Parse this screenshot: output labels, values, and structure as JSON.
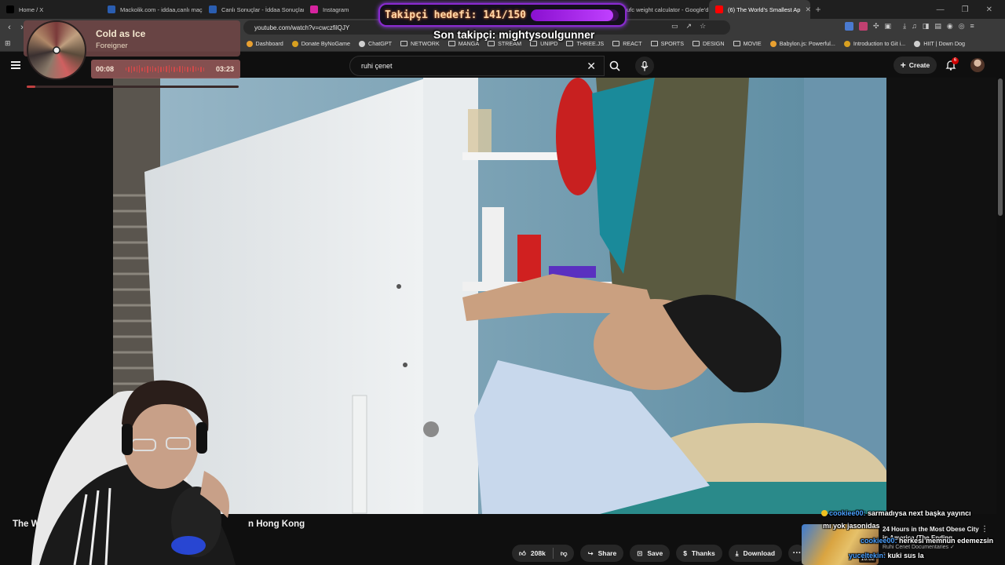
{
  "browser": {
    "tabs": [
      {
        "label": "Home / X",
        "icon": "x-icon",
        "color": "#000000"
      },
      {
        "label": "Mackolik.com - iddaa,canlı maç",
        "icon": "mackolik-icon",
        "color": "#2a5db0"
      },
      {
        "label": "Canlı Sonuçlar - İddaa Sonuçlar",
        "icon": "mackolik-icon",
        "color": "#2a5db0"
      },
      {
        "label": "Instagram",
        "icon": "instagram-icon",
        "color": "#d6249f"
      },
      {
        "label": "Instagram",
        "icon": "instagram-icon",
        "color": "#d6249f"
      },
      {
        "label": "Instagram",
        "icon": "instagram-icon",
        "color": "#d6249f"
      },
      {
        "label": "ufc weight calculator - Google'd",
        "icon": "google-icon",
        "color": "#ffffff"
      },
      {
        "label": "(6) The World's Smallest Ap",
        "icon": "youtube-icon",
        "color": "#ff0000",
        "active": true
      }
    ],
    "url": "youtube.com/watch?v=cwczfilQJY",
    "bookmarks": [
      {
        "label": "Dashboard",
        "type": "link"
      },
      {
        "label": "Donate ByNoGame",
        "type": "link"
      },
      {
        "label": "ChatGPT",
        "type": "link"
      },
      {
        "label": "NETWORK",
        "type": "folder"
      },
      {
        "label": "MANGA",
        "type": "folder"
      },
      {
        "label": "STREAM",
        "type": "folder"
      },
      {
        "label": "UNIPD",
        "type": "folder"
      },
      {
        "label": "THREE.JS",
        "type": "folder"
      },
      {
        "label": "REACT",
        "type": "folder"
      },
      {
        "label": "SPORTS",
        "type": "folder"
      },
      {
        "label": "DESIGN",
        "type": "folder"
      },
      {
        "label": "MOVIE",
        "type": "folder"
      },
      {
        "label": "Babylon.js: Powerful...",
        "type": "link"
      },
      {
        "label": "Introduction to Git i...",
        "type": "link"
      },
      {
        "label": "HIIT | Down Dog",
        "type": "link"
      }
    ]
  },
  "youtube": {
    "search_value": "ruhi çenet",
    "create_label": "Create",
    "notification_count": "6",
    "video_title_start": "The W",
    "video_title_end": "n Hong Kong",
    "actions": {
      "likes": "208k",
      "share": "Share",
      "save": "Save",
      "thanks": "Thanks",
      "download": "Download"
    },
    "recommended": {
      "title": "24 Hours in the Most Obese City in America (The Ending",
      "channel": "Ruhi Cenet Documentaries",
      "meta": "3 weeks ago",
      "duration": "16:02"
    }
  },
  "overlay": {
    "follow_goal": {
      "text": "Takipçi hedefi: 141/150",
      "current": 141,
      "target": 150
    },
    "last_follower": "Son takipçi: mightysoulgunner",
    "music": {
      "title": "Cold as Ice",
      "artist": "Foreigner",
      "current_time": "00:08",
      "total_time": "03:23",
      "progress": 0.04
    },
    "chat": [
      {
        "user": "cookiee00:",
        "message": "sarmadıysa next başka yayıncı"
      },
      {
        "user": "",
        "message": "mı yok jasonidas"
      },
      {
        "user": "cookiee00:",
        "message": "herkesi memnun edemezsin"
      },
      {
        "user": "yuceltekin:",
        "message": "kuki sus la"
      }
    ]
  }
}
